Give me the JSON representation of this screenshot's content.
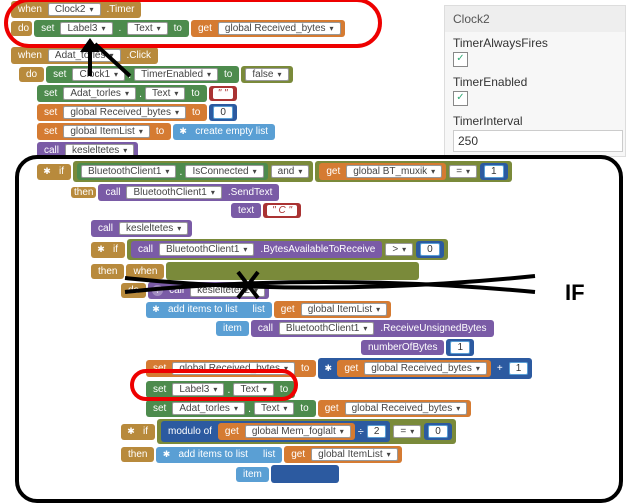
{
  "panel": {
    "title": "Clock2",
    "p1": "TimerAlwaysFires",
    "p2": "TimerEnabled",
    "p3": "TimerInterval",
    "interval": "250"
  },
  "b1": {
    "when": "when",
    "comp": "Clock2",
    "evt": ".Timer",
    "do": "do",
    "set": "set",
    "target": "Label3",
    "prop": "Text",
    "to": "to",
    "get": "get",
    "var": "global Received_bytes"
  },
  "b2": {
    "when": "when",
    "comp": "Adat_torles",
    "evt": ".Click",
    "do": "do",
    "r1": {
      "set": "set",
      "t": "Clock1",
      "p": "TimerEnabled",
      "to": "to",
      "v": "false"
    },
    "r2": {
      "set": "set",
      "t": "Adat_torles",
      "p": "Text",
      "to": "to",
      "v": " "
    },
    "r3": {
      "set": "set",
      "t": "global Received_bytes",
      "to": "to",
      "v": "0"
    },
    "r4": {
      "set": "set",
      "t": "global ItemList",
      "to": "to",
      "op": "create empty list"
    },
    "r5": {
      "call": "call",
      "fn": "kesleltetes"
    },
    "if": {
      "if": "if",
      "bt": "BluetoothClient1",
      "isc": "IsConnected",
      "and": "and",
      "get": "get",
      "gv": "global BT_muxik",
      "eq": "=",
      "one": "1",
      "then": "then",
      "st": {
        "call": "call",
        "t": "BluetoothClient1",
        "m": ".SendText",
        "arg": "text",
        "v": "C"
      },
      "k": {
        "call": "call",
        "t": "kesleltetes"
      },
      "if2": {
        "if": "if",
        "call": "call",
        "t": "BluetoothClient1",
        "m": ".BytesAvailableToReceive",
        "op": ">",
        "z": "0",
        "then": "then",
        "wh": {
          "when": "when",
          "do": "do",
          "call": "call",
          "fn": "kesleltetes2",
          "add": {
            "op": "add items to list",
            "list": "list",
            "get": "get",
            "gv": "global ItemList",
            "item": "item",
            "call": "call",
            "bt": "BluetoothClient1",
            "m": ".ReceiveUnsignedBytes",
            "nb": "numberOfBytes",
            "one": "1"
          },
          "set": {
            "set": "set",
            "t": "global Received_bytes",
            "to": "to",
            "get": "get",
            "gv": "global Received_bytes",
            "plus": "+",
            "one": "1"
          },
          "lbl": {
            "set": "set",
            "t": "Label3",
            "p": "Text",
            "to": "to"
          },
          "adt": {
            "set": "set",
            "t": "Adat_torles",
            "p": "Text",
            "to": "to",
            "get": "get",
            "gv": "global Received_bytes"
          }
        },
        "if3": {
          "if": "if",
          "mod": "modulo of",
          "get": "get",
          "gv": "global Mem_foglalt",
          "eq": "=",
          "two": "2",
          "z": "0",
          "then": "then",
          "add": {
            "op": "add items to list",
            "list": "list",
            "get": "get",
            "gv": "global ItemList",
            "item": "item"
          }
        }
      }
    }
  },
  "ann": {
    "if": "IF"
  }
}
